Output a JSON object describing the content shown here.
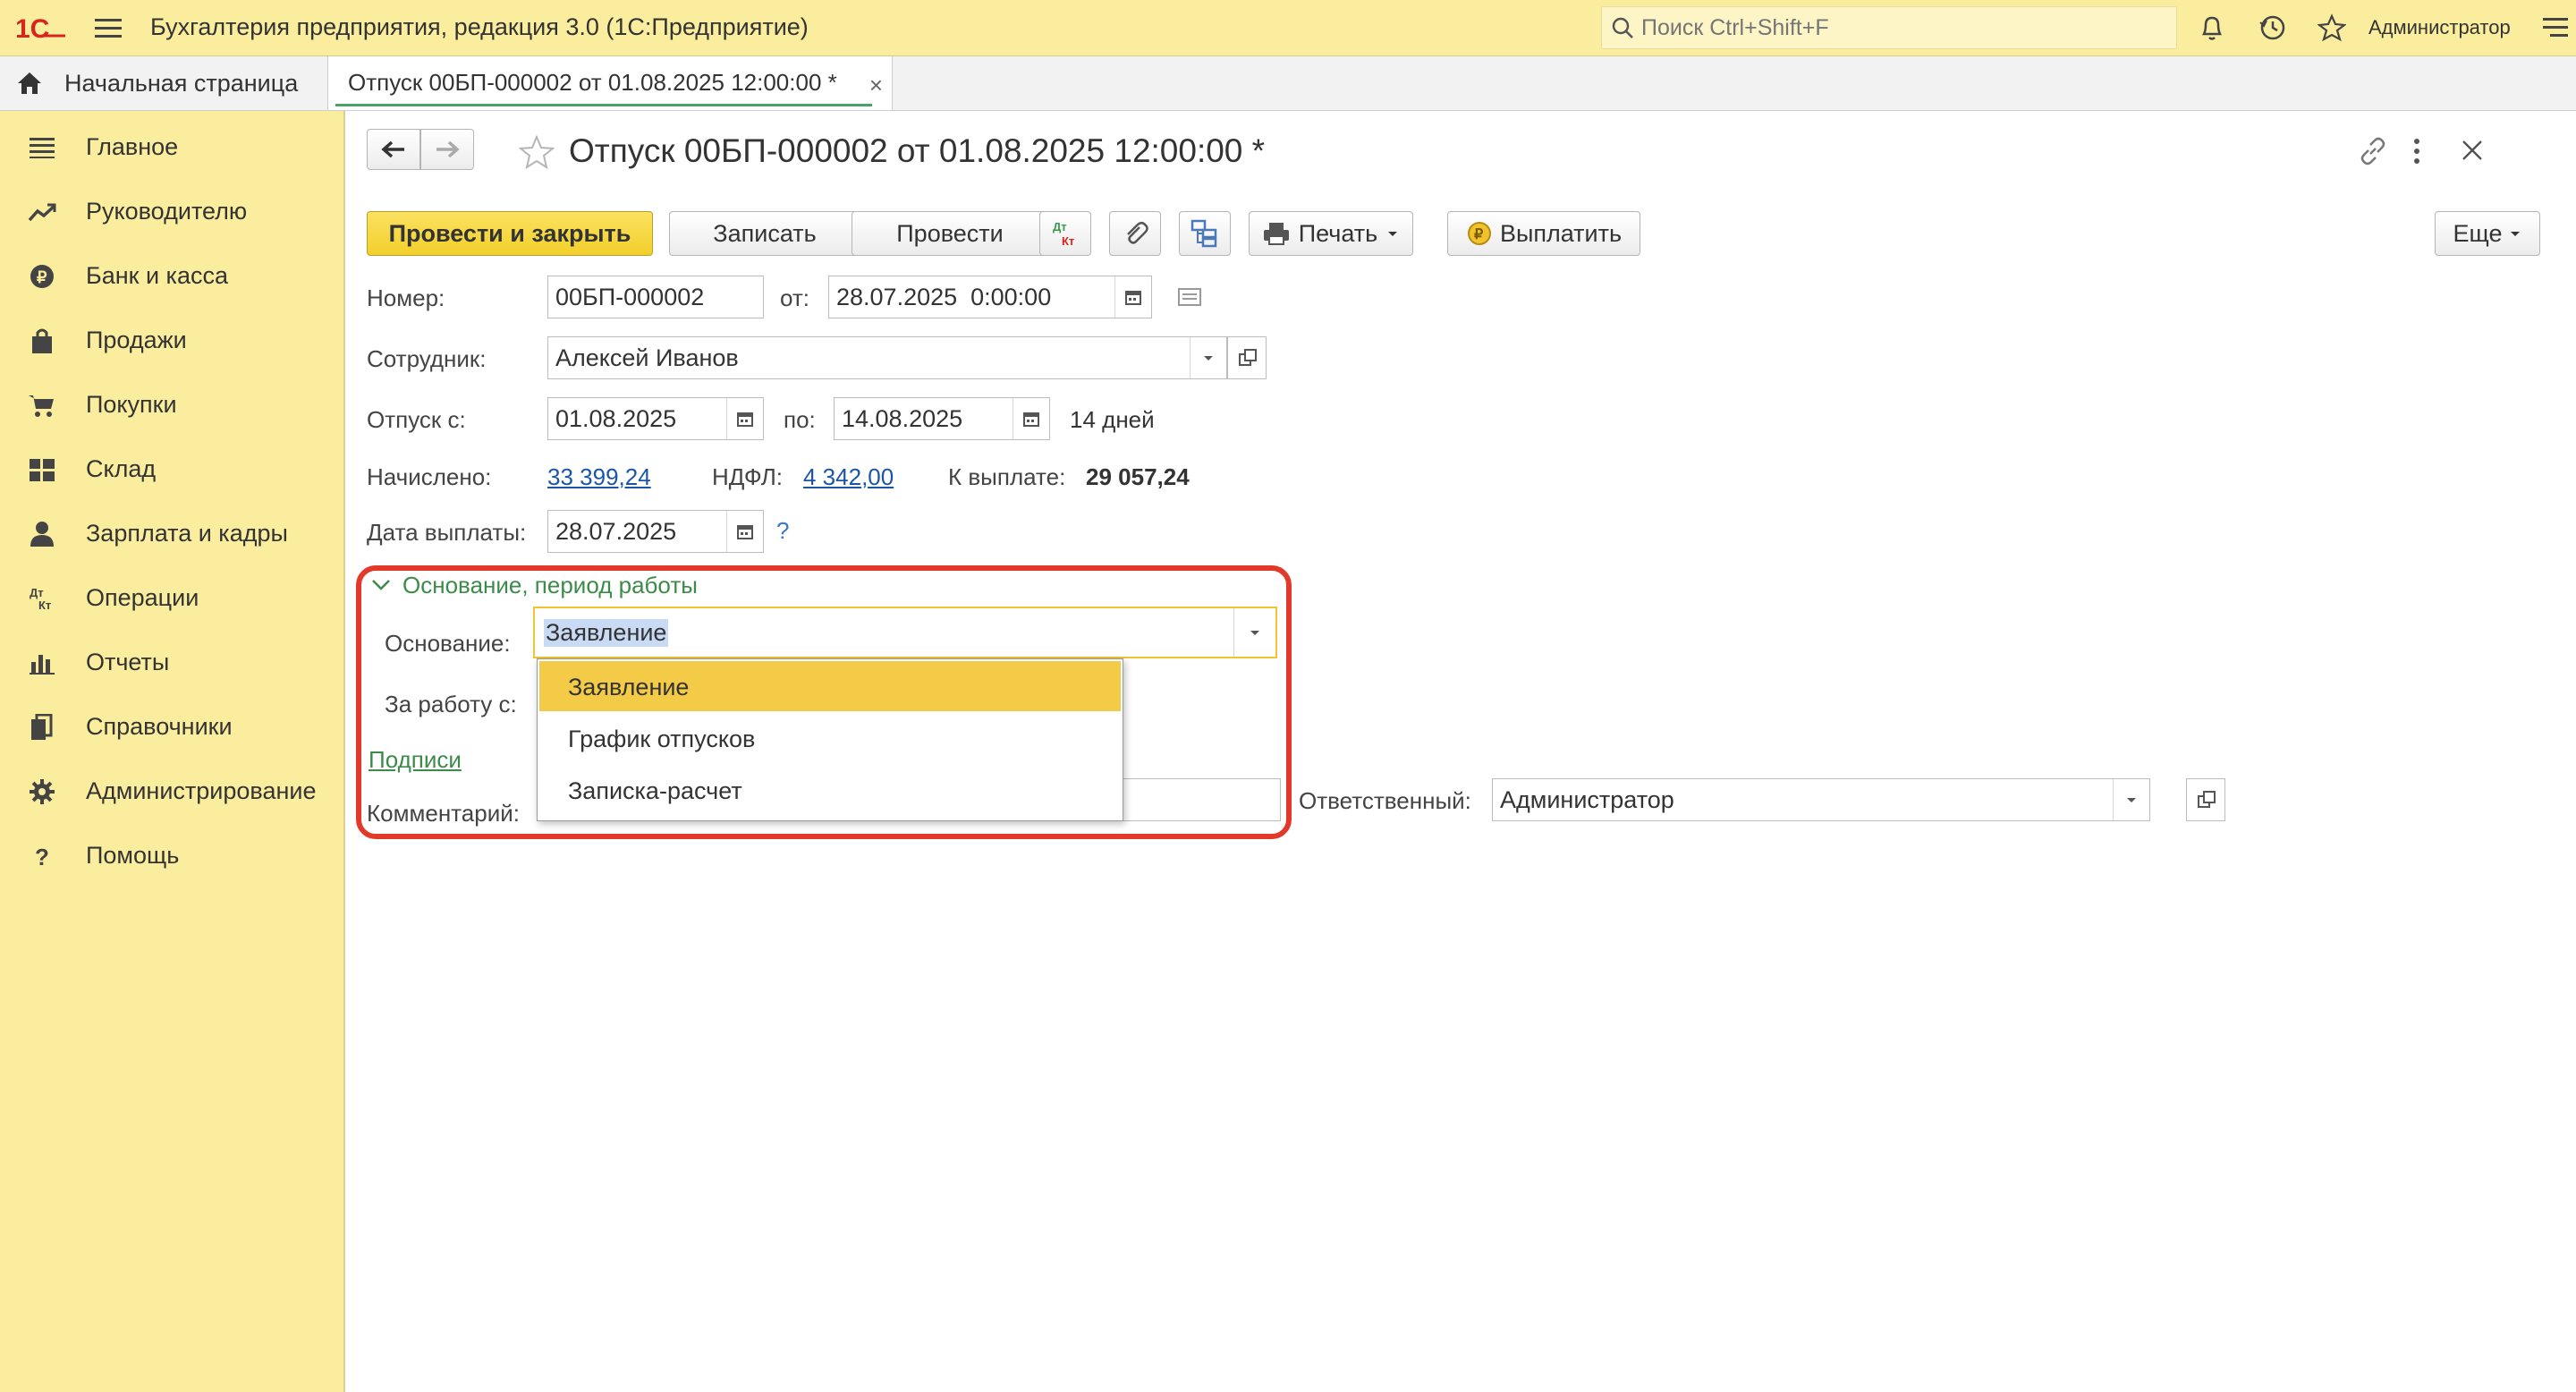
{
  "app": {
    "logo_text": "1С",
    "title": "Бухгалтерия предприятия, редакция 3.0  (1С:Предприятие)",
    "search_placeholder": "Поиск Ctrl+Shift+F",
    "user": "Администратор"
  },
  "tabs": {
    "home_label": "Начальная страница",
    "document_label": "Отпуск 00БП-000002 от 01.08.2025 12:00:00 *",
    "close_glyph": "×"
  },
  "sidebar": {
    "items": [
      {
        "label": "Главное",
        "icon": "menu-icon"
      },
      {
        "label": "Руководителю",
        "icon": "trend-icon"
      },
      {
        "label": "Банк и касса",
        "icon": "ruble-coin-icon"
      },
      {
        "label": "Продажи",
        "icon": "shopping-bag-icon"
      },
      {
        "label": "Покупки",
        "icon": "cart-icon"
      },
      {
        "label": "Склад",
        "icon": "warehouse-icon"
      },
      {
        "label": "Зарплата и кадры",
        "icon": "person-icon"
      },
      {
        "label": "Операции",
        "icon": "dt-kt-icon"
      },
      {
        "label": "Отчеты",
        "icon": "bar-chart-icon"
      },
      {
        "label": "Справочники",
        "icon": "books-icon"
      },
      {
        "label": "Администрирование",
        "icon": "gear-icon"
      },
      {
        "label": "Помощь",
        "icon": "question-icon"
      }
    ]
  },
  "document": {
    "title": "Отпуск 00БП-000002 от 01.08.2025 12:00:00 *",
    "toolbar": {
      "post_close": "Провести и закрыть",
      "save": "Записать",
      "post": "Провести",
      "print": "Печать",
      "pay": "Выплатить",
      "more": "Еще",
      "dtkt_top": "Дт",
      "dtkt_bottom": "Кт"
    },
    "number_label": "Номер:",
    "number_value": "00БП-000002",
    "from_label": "от:",
    "from_value": "28.07.2025  0:00:00",
    "employee_label": "Сотрудник:",
    "employee_value": "Алексей Иванов",
    "vacation_from_label": "Отпуск с:",
    "vacation_from_value": "01.08.2025",
    "vacation_to_label": "по:",
    "vacation_to_value": "14.08.2025",
    "days_text": "14 дней",
    "accrued_label": "Начислено:",
    "accrued_value": "33 399,24",
    "ndfl_label": "НДФЛ:",
    "ndfl_value": "4 342,00",
    "payout_label": "К выплате:",
    "payout_value": "29 057,24",
    "pay_date_label": "Дата выплаты:",
    "pay_date_value": "28.07.2025",
    "help_glyph": "?",
    "section_title": "Основание, период работы",
    "basis_label": "Основание:",
    "basis_value": "Заявление",
    "work_period_label": "За работу с:",
    "signatures_link": "Подписи",
    "comment_label": "Комментарий:",
    "responsible_label": "Ответственный:",
    "responsible_value": "Администратор",
    "basis_options": [
      "Заявление",
      "График отпусков",
      "Записка-расчет"
    ]
  },
  "colors": {
    "topbar": "#fbed9e",
    "primary_button": "#f2cf2b",
    "selected_option": "#f3cb47",
    "section_green": "#3d8b4a",
    "link_blue": "#1a55a8",
    "highlight_red": "#e3392b"
  }
}
